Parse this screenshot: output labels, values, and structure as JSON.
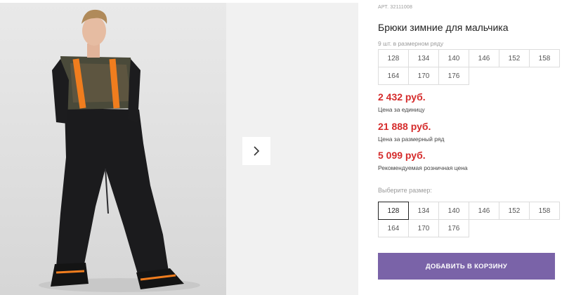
{
  "product": {
    "sku": "АРТ. 32111008",
    "title": "Брюки зимние для мальчика"
  },
  "pack": {
    "label": "9 шт. в размерном ряду",
    "sizes": [
      "128",
      "134",
      "140",
      "146",
      "152",
      "158",
      "164",
      "170",
      "176"
    ]
  },
  "prices": {
    "unit_price": "2 432 руб.",
    "unit_label": "Цена за единицу",
    "pack_price": "21 888 руб.",
    "pack_label": "Цена за размерный ряд",
    "retail_price": "5 099 руб.",
    "retail_label": "Рекомендуемая розничная цена"
  },
  "size_select": {
    "label": "Выберите размер:",
    "selected": "128",
    "options": [
      "128",
      "134",
      "140",
      "146",
      "152",
      "158",
      "164",
      "170",
      "176"
    ]
  },
  "cart": {
    "button_label": "ДОБАВИТЬ В КОРЗИНУ"
  },
  "gallery": {
    "next_icon": "chevron-right-icon"
  },
  "colors": {
    "price": "#d52b2b",
    "button": "#7a63a8",
    "suspenders": "#f07d1e"
  }
}
